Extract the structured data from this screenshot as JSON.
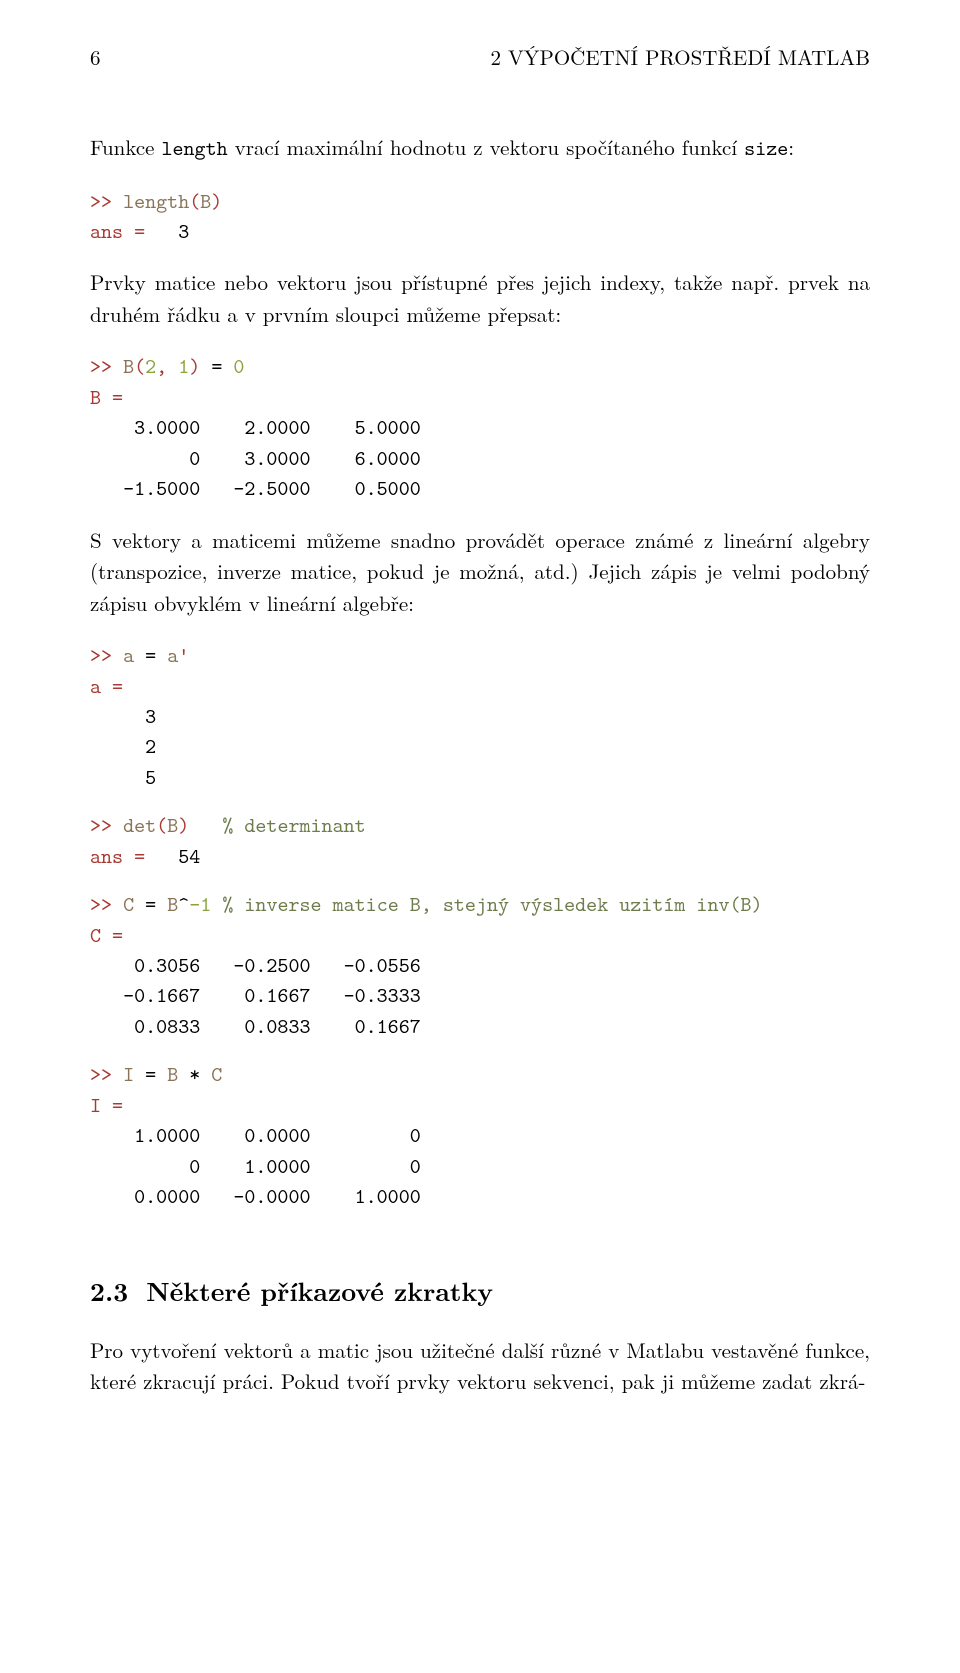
{
  "header": {
    "page_number": "6",
    "running_title": "2    VÝPOČETNÍ PROSTŘEDÍ MATLAB"
  },
  "para": {
    "p1_a": "Funkce ",
    "p1_tt1": "length",
    "p1_b": " vrací maximální hodnotu z vektoru spočítaného funkcí ",
    "p1_tt2": "size",
    "p1_c": ":",
    "p2": "Prvky matice nebo vektoru jsou přístupné přes jejich indexy, takže např. prvek na druhém řádku a v prvním sloupci můžeme přepsat:",
    "p3": "S vektory a maticemi můžeme snadno provádět operace známé z lineární algebry (transpozice, inverze matice, pokud je možná, atd.) Jejich zápis je velmi podobný zápisu obvyklém v lineární algebře:",
    "p4": "Pro vytvoření vektorů a matic jsou užitečné další různé v Matlabu vestavěné funkce, které zkracují práci. Pokud tvoří prvky vektoru sekvenci, pak ji můžeme zadat zkrá-"
  },
  "section": {
    "num": "2.3",
    "title": "Některé příkazové zkratky"
  },
  "tok": {
    "prompt": ">> ",
    "ans_eq": "ans = ",
    "eq": " = ",
    "op_eq": "=",
    "op_assign": "= ",
    "sp_assign": " = ",
    "op_mul": " * ",
    "op_pow": "^",
    "op_trans": "'",
    "comma": ", ",
    "lparen": "(",
    "rparen": ")"
  },
  "code1": {
    "func": "length",
    "arg": "B",
    "result": "  3"
  },
  "code2": {
    "lhs_var": "B",
    "idx1": "2",
    "idx2": "1",
    "rhs": "0",
    "out_label": "B =",
    "row1": "    3.0000    2.0000    5.0000",
    "row2": "         0    3.0000    6.0000",
    "row3": "   -1.5000   -2.5000    0.5000"
  },
  "code3": {
    "var": "a",
    "out_label": "a =",
    "r1": "     3",
    "r2": "     2",
    "r3": "     5"
  },
  "code4": {
    "func": "det",
    "arg": "B",
    "comment": "% determinant",
    "result": "  54"
  },
  "code5": {
    "lhs": "C",
    "base": "B",
    "power": "-1",
    "comment": "% inverse matice B, stejný výsledek uzitím inv(B)",
    "out_label": "C =",
    "r1": "    0.3056   -0.2500   -0.0556",
    "r2": "   -0.1667    0.1667   -0.3333",
    "r3": "    0.0833    0.0833    0.1667"
  },
  "code6": {
    "lhs": "I",
    "a": "B",
    "b": "C",
    "out_label": "I =",
    "r1": "    1.0000    0.0000         0",
    "r2": "         0    1.0000         0",
    "r3": "    0.0000   -0.0000    1.0000"
  }
}
